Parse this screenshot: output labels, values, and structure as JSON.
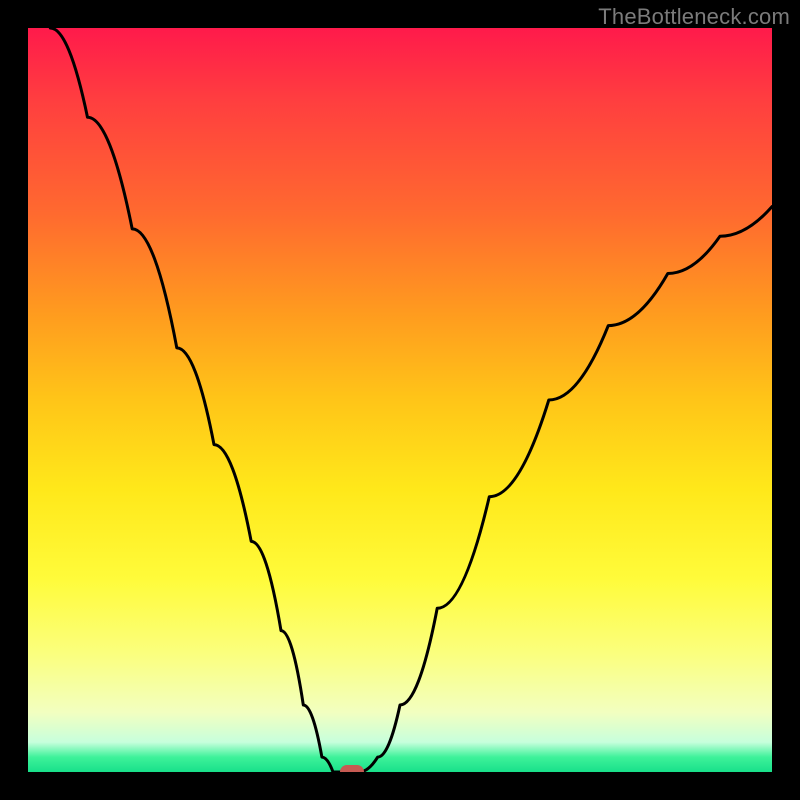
{
  "watermark": "TheBottleneck.com",
  "chart_data": {
    "type": "line",
    "title": "",
    "xlabel": "",
    "ylabel": "",
    "xlim": [
      0,
      1
    ],
    "ylim": [
      0,
      1
    ],
    "series": [
      {
        "name": "curve",
        "x": [
          0.03,
          0.08,
          0.14,
          0.2,
          0.25,
          0.3,
          0.34,
          0.37,
          0.395,
          0.41,
          0.425,
          0.445,
          0.47,
          0.5,
          0.55,
          0.62,
          0.7,
          0.78,
          0.86,
          0.93,
          1.0
        ],
        "values": [
          1.0,
          0.88,
          0.73,
          0.57,
          0.44,
          0.31,
          0.19,
          0.09,
          0.02,
          0.0,
          0.0,
          0.0,
          0.02,
          0.09,
          0.22,
          0.37,
          0.5,
          0.6,
          0.67,
          0.72,
          0.76
        ]
      }
    ],
    "marker": {
      "x": 0.435,
      "y": 0.0
    },
    "gradient_stops": [
      {
        "pos": 0.0,
        "color": "#ff1a4b"
      },
      {
        "pos": 0.25,
        "color": "#ff6a2f"
      },
      {
        "pos": 0.5,
        "color": "#ffc518"
      },
      {
        "pos": 0.75,
        "color": "#fffb3a"
      },
      {
        "pos": 0.96,
        "color": "#c7ffdc"
      },
      {
        "pos": 1.0,
        "color": "#18e08a"
      }
    ]
  }
}
